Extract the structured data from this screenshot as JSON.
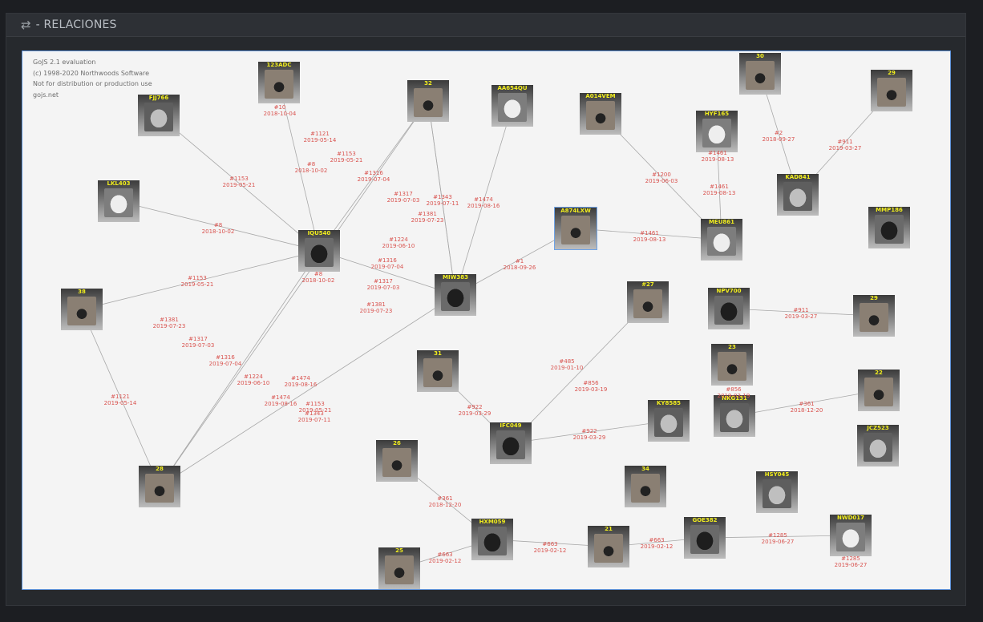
{
  "panel": {
    "title": "- RELACIONES",
    "icon": "retweet-icon"
  },
  "watermark": [
    "GoJS 2.1 evaluation",
    "(c) 1998-2020 Northwoods Software",
    "Not for distribution or production use",
    "gojs.net"
  ],
  "colors": {
    "edge_label": "#d9534f",
    "node_label": "#f2ee1e",
    "link": "#a8a8a8",
    "canvas": "#f4f4f4"
  },
  "nodes": [
    {
      "label": "123ADC",
      "kind": "motorcycle"
    },
    {
      "label": "FJJ766",
      "kind": "car-silver"
    },
    {
      "label": "32",
      "kind": "motorcycle"
    },
    {
      "label": "AA654QU",
      "kind": "car-white"
    },
    {
      "label": "A014VEM",
      "kind": "motorcycle"
    },
    {
      "label": "HYF165",
      "kind": "car-white"
    },
    {
      "label": "30",
      "kind": "motorcycle"
    },
    {
      "label": "29",
      "kind": "motorcycle"
    },
    {
      "label": "LKL403",
      "kind": "car-white"
    },
    {
      "label": "KAD841",
      "kind": "car-silver"
    },
    {
      "label": "MMP186",
      "kind": "car-dark"
    },
    {
      "label": "IQU540",
      "kind": "car-dark"
    },
    {
      "label": "A874LXW",
      "kind": "motorcycle"
    },
    {
      "label": "MEU861",
      "kind": "car-white"
    },
    {
      "label": "MIW383",
      "kind": "car-dark"
    },
    {
      "label": "38",
      "kind": "motorcycle"
    },
    {
      "label": "#27",
      "kind": "motorcycle"
    },
    {
      "label": "NPV700",
      "kind": "car-dark"
    },
    {
      "label": "29",
      "kind": "motorcycle"
    },
    {
      "label": "23",
      "kind": "motorcycle"
    },
    {
      "label": "31",
      "kind": "motorcycle"
    },
    {
      "label": "22",
      "kind": "motorcycle"
    },
    {
      "label": "KY8585",
      "kind": "car-silver"
    },
    {
      "label": "NKG131",
      "kind": "car-silver"
    },
    {
      "label": "IFC049",
      "kind": "car-dark"
    },
    {
      "label": "JCZ523",
      "kind": "car-silver"
    },
    {
      "label": "28",
      "kind": "motorcycle"
    },
    {
      "label": "26",
      "kind": "motorcycle"
    },
    {
      "label": "34",
      "kind": "motorcycle"
    },
    {
      "label": "HSY045",
      "kind": "car-silver"
    },
    {
      "label": "HXM059",
      "kind": "car-dark"
    },
    {
      "label": "21",
      "kind": "motorcycle"
    },
    {
      "label": "GOE382",
      "kind": "car-dark"
    },
    {
      "label": "NWD017",
      "kind": "car-white"
    },
    {
      "label": "25",
      "kind": "motorcycle"
    }
  ],
  "edge_labels": [
    {
      "id": "#10",
      "date": "2018-10-04"
    },
    {
      "id": "#1121",
      "date": "2019-05-14"
    },
    {
      "id": "#1153",
      "date": "2019-05-21"
    },
    {
      "id": "#8",
      "date": "2018-10-02"
    },
    {
      "id": "#1316",
      "date": "2019-07-04"
    },
    {
      "id": "#1317",
      "date": "2019-07-03"
    },
    {
      "id": "#1343",
      "date": "2019-07-11"
    },
    {
      "id": "#1381",
      "date": "2019-07-23"
    },
    {
      "id": "#1474",
      "date": "2019-08-16"
    },
    {
      "id": "#1153",
      "date": "2019-05-21"
    },
    {
      "id": "#8",
      "date": "2018-10-02"
    },
    {
      "id": "#1224",
      "date": "2019-06-10"
    },
    {
      "id": "#1316",
      "date": "2019-07-04"
    },
    {
      "id": "#1317",
      "date": "2019-07-03"
    },
    {
      "id": "#1381",
      "date": "2019-07-23"
    },
    {
      "id": "#8",
      "date": "2018-10-02"
    },
    {
      "id": "#1153",
      "date": "2019-05-21"
    },
    {
      "id": "#1474",
      "date": "2019-08-16"
    },
    {
      "id": "#1381",
      "date": "2019-07-23"
    },
    {
      "id": "#1317",
      "date": "2019-07-03"
    },
    {
      "id": "#1316",
      "date": "2019-07-04"
    },
    {
      "id": "#1224",
      "date": "2019-06-10"
    },
    {
      "id": "#1474",
      "date": "2019-08-16"
    },
    {
      "id": "#1153",
      "date": "2019-05-21"
    },
    {
      "id": "#1343",
      "date": "2019-07-11"
    },
    {
      "id": "#1121",
      "date": "2019-05-14"
    },
    {
      "id": "#1200",
      "date": "2019-06-03"
    },
    {
      "id": "#1461",
      "date": "2019-08-13"
    },
    {
      "id": "#1461",
      "date": "2019-08-13"
    },
    {
      "id": "#1461",
      "date": "2019-08-13"
    },
    {
      "id": "#2",
      "date": "2018-09-27"
    },
    {
      "id": "#911",
      "date": "2019-03-27"
    },
    {
      "id": "#911",
      "date": "2019-03-27"
    },
    {
      "id": "#485",
      "date": "2019-01-10"
    },
    {
      "id": "#856",
      "date": "2019-03-19"
    },
    {
      "id": "#922",
      "date": "2019-03-29"
    },
    {
      "id": "#922",
      "date": "2019-03-29"
    },
    {
      "id": "#856",
      "date": "2019-03-19"
    },
    {
      "id": "#361",
      "date": "2018-12-20"
    },
    {
      "id": "#361",
      "date": "2018-12-20"
    },
    {
      "id": "#663",
      "date": "2019-02-12"
    },
    {
      "id": "#663",
      "date": "2019-02-12"
    },
    {
      "id": "#663",
      "date": "2019-02-12"
    },
    {
      "id": "#1285",
      "date": "2019-06-27"
    },
    {
      "id": "#1285",
      "date": "2019-06-27"
    },
    {
      "id": "#1",
      "date": "2018-09-26"
    }
  ]
}
